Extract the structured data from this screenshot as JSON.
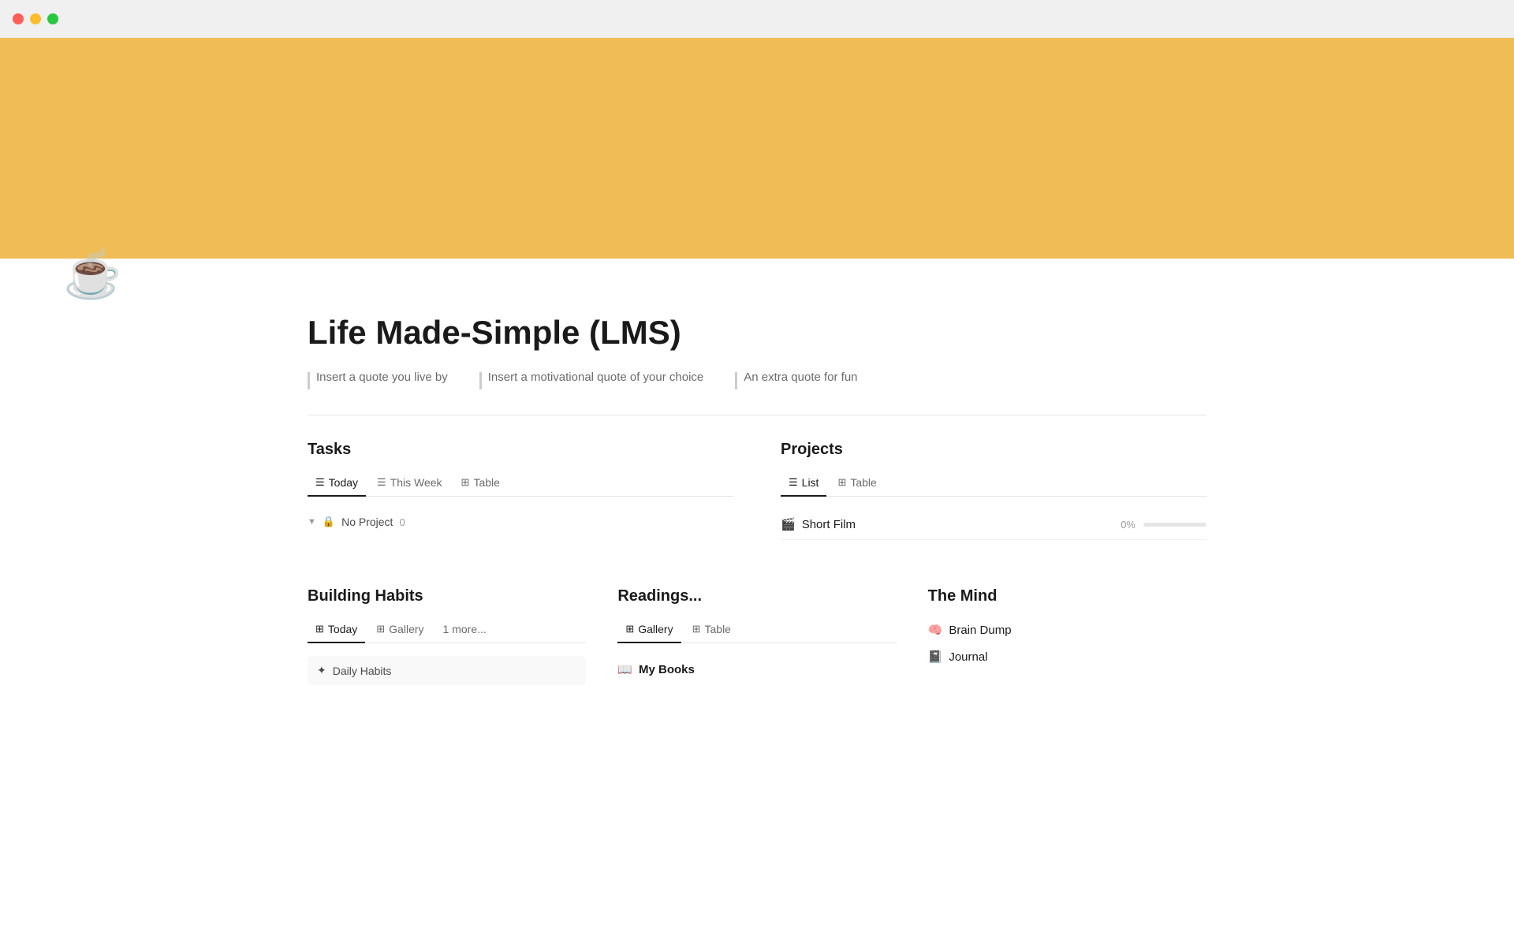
{
  "titlebar": {
    "close_color": "#ff5f57",
    "minimize_color": "#febc2e",
    "maximize_color": "#28c840"
  },
  "hero": {
    "background_color": "#f0bc55",
    "icon": "☕"
  },
  "page": {
    "title": "Life Made-Simple (LMS)",
    "quote1": "Insert a quote you live by",
    "quote2": "Insert a motivational quote of your choice",
    "quote3": "An extra quote for fun"
  },
  "tasks": {
    "section_title": "Tasks",
    "tabs": [
      {
        "label": "Today",
        "icon": "≡",
        "active": true
      },
      {
        "label": "This Week",
        "icon": "≡",
        "active": false
      },
      {
        "label": "Table",
        "icon": "⊞",
        "active": false
      }
    ],
    "no_project_label": "No Project",
    "no_project_count": "0"
  },
  "projects": {
    "section_title": "Projects",
    "tabs": [
      {
        "label": "List",
        "icon": "≡",
        "active": true
      },
      {
        "label": "Table",
        "icon": "⊞",
        "active": false
      }
    ],
    "items": [
      {
        "icon": "🎬",
        "name": "Short Film",
        "progress": 0,
        "progress_label": "0%"
      }
    ]
  },
  "building_habits": {
    "section_title": "Building Habits",
    "tabs": [
      {
        "label": "Today",
        "icon": "⊞",
        "active": true
      },
      {
        "label": "Gallery",
        "icon": "⊞",
        "active": false
      },
      {
        "label": "1 more...",
        "icon": "",
        "active": false
      }
    ],
    "items": [
      {
        "icon": "✦",
        "label": "Daily Habits"
      }
    ]
  },
  "readings": {
    "section_title": "Readings...",
    "tabs": [
      {
        "label": "Gallery",
        "icon": "⊞",
        "active": true
      },
      {
        "label": "Table",
        "icon": "⊞",
        "active": false
      }
    ],
    "book_icon": "📖",
    "book_label": "My Books"
  },
  "the_mind": {
    "section_title": "The Mind",
    "items": [
      {
        "icon": "🧠",
        "label": "Brain Dump"
      },
      {
        "icon": "📓",
        "label": "Journal"
      }
    ]
  }
}
